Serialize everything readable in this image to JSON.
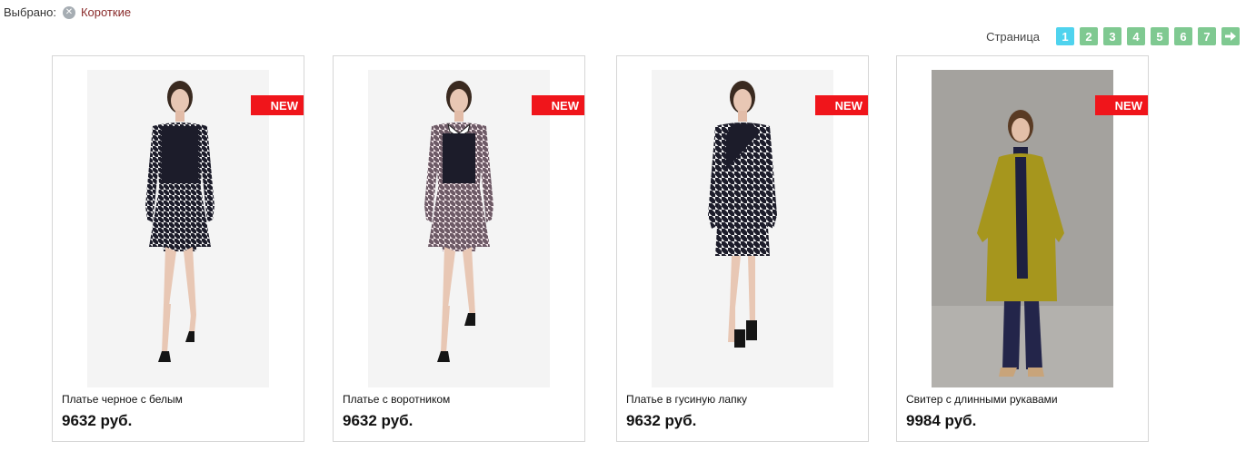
{
  "filter": {
    "label": "Выбрано:",
    "chip_text": "Короткие"
  },
  "pagination": {
    "label": "Страница",
    "pages": [
      "1",
      "2",
      "3",
      "4",
      "5",
      "6",
      "7"
    ],
    "active": "1",
    "colors": {
      "active": "#4fd3ee",
      "inactive": "#7fc991"
    }
  },
  "badge_color": "#f0151b",
  "products": [
    {
      "badge": "NEW",
      "name": "Платье черное с белым",
      "price": "9632 руб.",
      "image": "model-black-white-houndstooth-dress"
    },
    {
      "badge": "NEW",
      "name": "Платье с воротником",
      "price": "9632 руб.",
      "image": "model-pink-houndstooth-collar-dress"
    },
    {
      "badge": "NEW",
      "name": "Платье в гусиную лапку",
      "price": "9632 руб.",
      "image": "model-houndstooth-wrap-dress"
    },
    {
      "badge": "NEW",
      "name": "Свитер с длинными рукавами",
      "price": "9984 руб.",
      "image": "model-mustard-coat"
    }
  ]
}
